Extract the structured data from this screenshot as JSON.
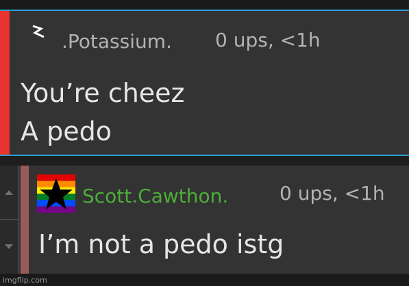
{
  "comment1": {
    "username": ".Potassium.",
    "meta": "0 ups, <1h",
    "lines": [
      "You’re cheez",
      "A pedo"
    ]
  },
  "comment2": {
    "username": "Scott.Cawthon.",
    "meta": "0 ups, <1h",
    "text": "I’m not a pedo istg"
  },
  "watermark": "imgflip.com",
  "icons": {
    "vote_up": "chevron-up-icon",
    "vote_down": "chevron-down-icon",
    "badge": "lightning-bolt-icon",
    "avatar": "pride-star-avatar"
  },
  "colors": {
    "comment_bg": "#333333",
    "border_blue": "#2c9fd6",
    "accent_red": "#e8332f",
    "accent_brown": "#9a5a5a",
    "username_green": "#4caf3a"
  }
}
